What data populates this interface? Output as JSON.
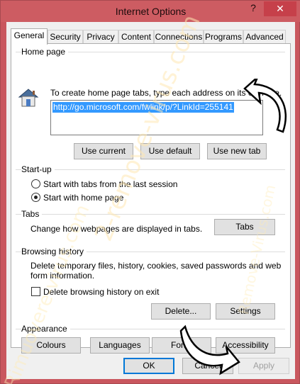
{
  "window": {
    "title": "Internet Options",
    "help_label": "?",
    "close_label": "✕"
  },
  "tabs": [
    {
      "label": "General",
      "active": true
    },
    {
      "label": "Security"
    },
    {
      "label": "Privacy"
    },
    {
      "label": "Content"
    },
    {
      "label": "Connections"
    },
    {
      "label": "Programs"
    },
    {
      "label": "Advanced"
    }
  ],
  "home_page": {
    "group_label": "Home page",
    "instructions": "To create home page tabs, type each address on its own line.",
    "url_value": "http://go.microsoft.com/fwlink/p/?LinkId=255141",
    "use_current_label": "Use current",
    "use_default_label": "Use default",
    "use_new_tab_label": "Use new tab"
  },
  "startup": {
    "group_label": "Start-up",
    "option_last_session": "Start with tabs from the last session",
    "option_home_page": "Start with home page",
    "selected": "home_page"
  },
  "tabs_section": {
    "group_label": "Tabs",
    "description": "Change how webpages are displayed in tabs.",
    "tabs_button_label": "Tabs"
  },
  "browsing_history": {
    "group_label": "Browsing history",
    "description_line1": "Delete temporary files, history, cookies, saved passwords and web",
    "description_line2": "form information.",
    "delete_on_exit_label": "Delete browsing history on exit",
    "delete_on_exit_checked": false,
    "delete_button_label": "Delete...",
    "settings_button_label": "Settings"
  },
  "appearance": {
    "group_label": "Appearance",
    "colours_label": "Colours",
    "languages_label": "Languages",
    "fonts_label": "Fonts",
    "accessibility_label": "Accessibility"
  },
  "dialog_buttons": {
    "ok_label": "OK",
    "cancel_label": "Cancel",
    "apply_label": "Apply"
  },
  "watermark": {
    "text_main": "2-remove-virus.com",
    "text_secondary": "Remove-Virus.com",
    "text_corner": "Rimuovere-virus.com"
  }
}
